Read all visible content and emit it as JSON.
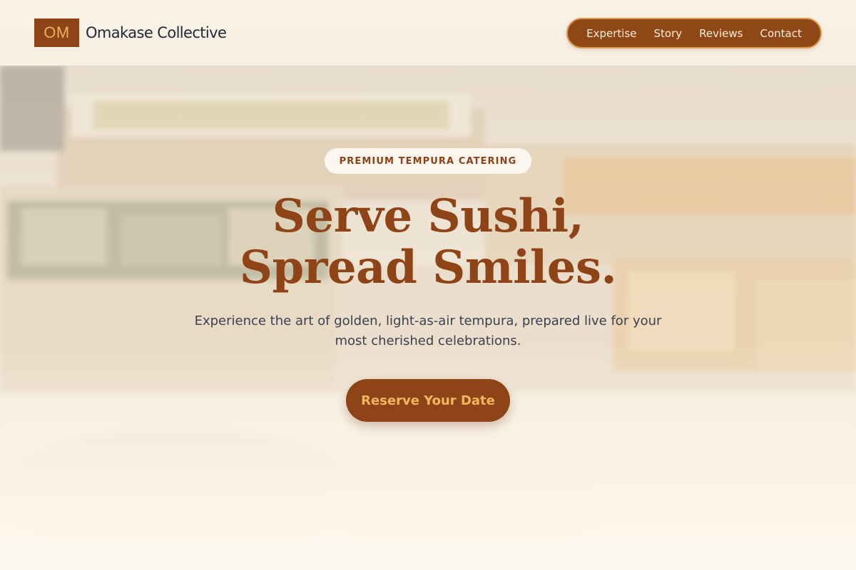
{
  "brand": {
    "logo_text": "OM",
    "name": "Omakase Collective"
  },
  "nav": {
    "items": [
      {
        "label": "Expertise"
      },
      {
        "label": "Story"
      },
      {
        "label": "Reviews"
      },
      {
        "label": "Contact"
      }
    ]
  },
  "hero": {
    "badge": "PREMIUM TEMPURA CATERING",
    "headline_line1": "Serve Sushi,",
    "headline_line2": "Spread Smiles.",
    "subtext": "Experience the art of golden, light-as-air tempura, prepared live for your most cherished celebrations.",
    "cta_label": "Reserve Your Date"
  },
  "colors": {
    "accent": "#8e4416",
    "accent_text": "#f1b65e",
    "nav_border": "#d99a4b",
    "heading": "#222a37",
    "body_text": "#3b4150",
    "background": "#f6ecdc"
  }
}
